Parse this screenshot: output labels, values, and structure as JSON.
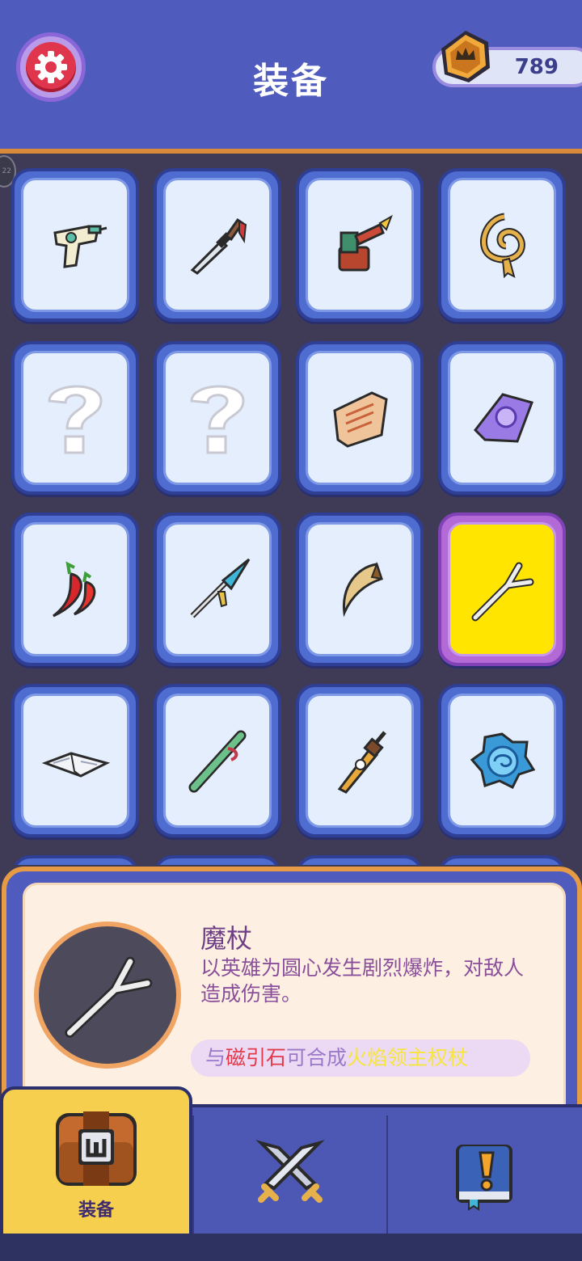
{
  "header": {
    "title": "装备",
    "coins": "789",
    "settings_icon": "gear-icon",
    "coin_icon": "crown-coin-icon"
  },
  "edge_badge": "22",
  "grid": {
    "items": [
      {
        "icon": "water-pistol-icon",
        "state": "unlocked"
      },
      {
        "icon": "dagger-icon",
        "state": "unlocked"
      },
      {
        "icon": "blowtorch-icon",
        "state": "unlocked"
      },
      {
        "icon": "whip-icon",
        "state": "unlocked"
      },
      {
        "icon": "unknown-item-icon",
        "state": "locked"
      },
      {
        "icon": "unknown-item-icon",
        "state": "locked"
      },
      {
        "icon": "scroll-orange-icon",
        "state": "unlocked"
      },
      {
        "icon": "scroll-purple-icon",
        "state": "unlocked"
      },
      {
        "icon": "chili-pepper-icon",
        "state": "unlocked"
      },
      {
        "icon": "spear-icon",
        "state": "unlocked"
      },
      {
        "icon": "claw-icon",
        "state": "unlocked"
      },
      {
        "icon": "magic-wand-icon",
        "state": "selected"
      },
      {
        "icon": "book-icon",
        "state": "unlocked"
      },
      {
        "icon": "bamboo-flute-icon",
        "state": "unlocked"
      },
      {
        "icon": "golden-sword-icon",
        "state": "unlocked"
      },
      {
        "icon": "blue-orb-icon",
        "state": "unlocked"
      }
    ]
  },
  "detail": {
    "name": "魔杖",
    "description": "以英雄为圆心发生剧烈爆炸，对敌人造成伤害。",
    "combo_prefix": "与",
    "combo_item": "磁引石",
    "combo_middle": "可合成",
    "combo_result": "火焰领主权杖",
    "icon": "magic-wand-icon"
  },
  "nav": {
    "tabs": [
      {
        "label": "装备",
        "icon": "treasure-chest-icon",
        "active": true
      },
      {
        "label": "",
        "icon": "crossed-swords-icon",
        "active": false
      },
      {
        "label": "",
        "icon": "quest-book-icon",
        "active": false
      }
    ]
  },
  "colors": {
    "header_bg": "#4f5cbd",
    "accent_orange": "#e79b44",
    "selected_slot": "#ffe500",
    "combo_red": "#e23a4b",
    "combo_yellow": "#f6e63b"
  }
}
